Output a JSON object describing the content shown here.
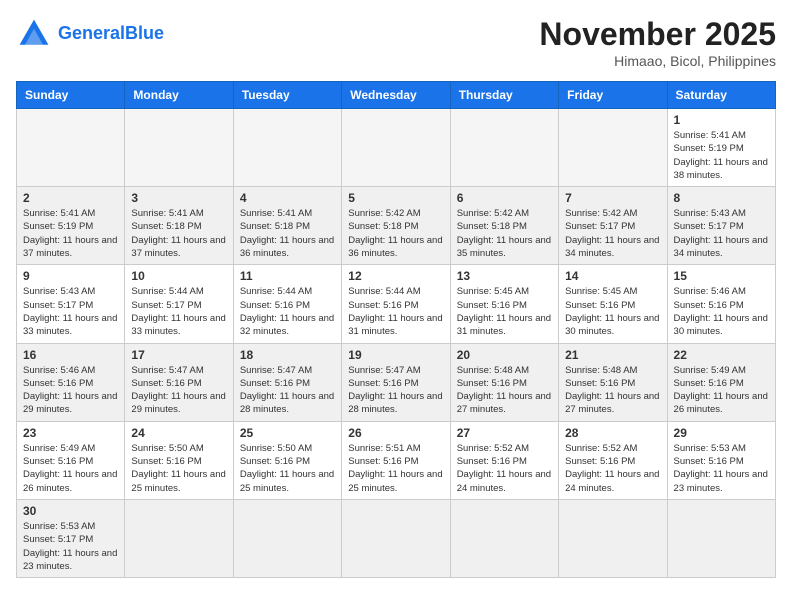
{
  "header": {
    "logo_general": "General",
    "logo_blue": "Blue",
    "month_title": "November 2025",
    "location": "Himaao, Bicol, Philippines"
  },
  "weekdays": [
    "Sunday",
    "Monday",
    "Tuesday",
    "Wednesday",
    "Thursday",
    "Friday",
    "Saturday"
  ],
  "weeks": [
    [
      {
        "day": "",
        "info": ""
      },
      {
        "day": "",
        "info": ""
      },
      {
        "day": "",
        "info": ""
      },
      {
        "day": "",
        "info": ""
      },
      {
        "day": "",
        "info": ""
      },
      {
        "day": "",
        "info": ""
      },
      {
        "day": "1",
        "info": "Sunrise: 5:41 AM\nSunset: 5:19 PM\nDaylight: 11 hours and 38 minutes."
      }
    ],
    [
      {
        "day": "2",
        "info": "Sunrise: 5:41 AM\nSunset: 5:19 PM\nDaylight: 11 hours and 37 minutes."
      },
      {
        "day": "3",
        "info": "Sunrise: 5:41 AM\nSunset: 5:18 PM\nDaylight: 11 hours and 37 minutes."
      },
      {
        "day": "4",
        "info": "Sunrise: 5:41 AM\nSunset: 5:18 PM\nDaylight: 11 hours and 36 minutes."
      },
      {
        "day": "5",
        "info": "Sunrise: 5:42 AM\nSunset: 5:18 PM\nDaylight: 11 hours and 36 minutes."
      },
      {
        "day": "6",
        "info": "Sunrise: 5:42 AM\nSunset: 5:18 PM\nDaylight: 11 hours and 35 minutes."
      },
      {
        "day": "7",
        "info": "Sunrise: 5:42 AM\nSunset: 5:17 PM\nDaylight: 11 hours and 34 minutes."
      },
      {
        "day": "8",
        "info": "Sunrise: 5:43 AM\nSunset: 5:17 PM\nDaylight: 11 hours and 34 minutes."
      }
    ],
    [
      {
        "day": "9",
        "info": "Sunrise: 5:43 AM\nSunset: 5:17 PM\nDaylight: 11 hours and 33 minutes."
      },
      {
        "day": "10",
        "info": "Sunrise: 5:44 AM\nSunset: 5:17 PM\nDaylight: 11 hours and 33 minutes."
      },
      {
        "day": "11",
        "info": "Sunrise: 5:44 AM\nSunset: 5:16 PM\nDaylight: 11 hours and 32 minutes."
      },
      {
        "day": "12",
        "info": "Sunrise: 5:44 AM\nSunset: 5:16 PM\nDaylight: 11 hours and 31 minutes."
      },
      {
        "day": "13",
        "info": "Sunrise: 5:45 AM\nSunset: 5:16 PM\nDaylight: 11 hours and 31 minutes."
      },
      {
        "day": "14",
        "info": "Sunrise: 5:45 AM\nSunset: 5:16 PM\nDaylight: 11 hours and 30 minutes."
      },
      {
        "day": "15",
        "info": "Sunrise: 5:46 AM\nSunset: 5:16 PM\nDaylight: 11 hours and 30 minutes."
      }
    ],
    [
      {
        "day": "16",
        "info": "Sunrise: 5:46 AM\nSunset: 5:16 PM\nDaylight: 11 hours and 29 minutes."
      },
      {
        "day": "17",
        "info": "Sunrise: 5:47 AM\nSunset: 5:16 PM\nDaylight: 11 hours and 29 minutes."
      },
      {
        "day": "18",
        "info": "Sunrise: 5:47 AM\nSunset: 5:16 PM\nDaylight: 11 hours and 28 minutes."
      },
      {
        "day": "19",
        "info": "Sunrise: 5:47 AM\nSunset: 5:16 PM\nDaylight: 11 hours and 28 minutes."
      },
      {
        "day": "20",
        "info": "Sunrise: 5:48 AM\nSunset: 5:16 PM\nDaylight: 11 hours and 27 minutes."
      },
      {
        "day": "21",
        "info": "Sunrise: 5:48 AM\nSunset: 5:16 PM\nDaylight: 11 hours and 27 minutes."
      },
      {
        "day": "22",
        "info": "Sunrise: 5:49 AM\nSunset: 5:16 PM\nDaylight: 11 hours and 26 minutes."
      }
    ],
    [
      {
        "day": "23",
        "info": "Sunrise: 5:49 AM\nSunset: 5:16 PM\nDaylight: 11 hours and 26 minutes."
      },
      {
        "day": "24",
        "info": "Sunrise: 5:50 AM\nSunset: 5:16 PM\nDaylight: 11 hours and 25 minutes."
      },
      {
        "day": "25",
        "info": "Sunrise: 5:50 AM\nSunset: 5:16 PM\nDaylight: 11 hours and 25 minutes."
      },
      {
        "day": "26",
        "info": "Sunrise: 5:51 AM\nSunset: 5:16 PM\nDaylight: 11 hours and 25 minutes."
      },
      {
        "day": "27",
        "info": "Sunrise: 5:52 AM\nSunset: 5:16 PM\nDaylight: 11 hours and 24 minutes."
      },
      {
        "day": "28",
        "info": "Sunrise: 5:52 AM\nSunset: 5:16 PM\nDaylight: 11 hours and 24 minutes."
      },
      {
        "day": "29",
        "info": "Sunrise: 5:53 AM\nSunset: 5:16 PM\nDaylight: 11 hours and 23 minutes."
      }
    ],
    [
      {
        "day": "30",
        "info": "Sunrise: 5:53 AM\nSunset: 5:17 PM\nDaylight: 11 hours and 23 minutes."
      },
      {
        "day": "",
        "info": ""
      },
      {
        "day": "",
        "info": ""
      },
      {
        "day": "",
        "info": ""
      },
      {
        "day": "",
        "info": ""
      },
      {
        "day": "",
        "info": ""
      },
      {
        "day": "",
        "info": ""
      }
    ]
  ]
}
